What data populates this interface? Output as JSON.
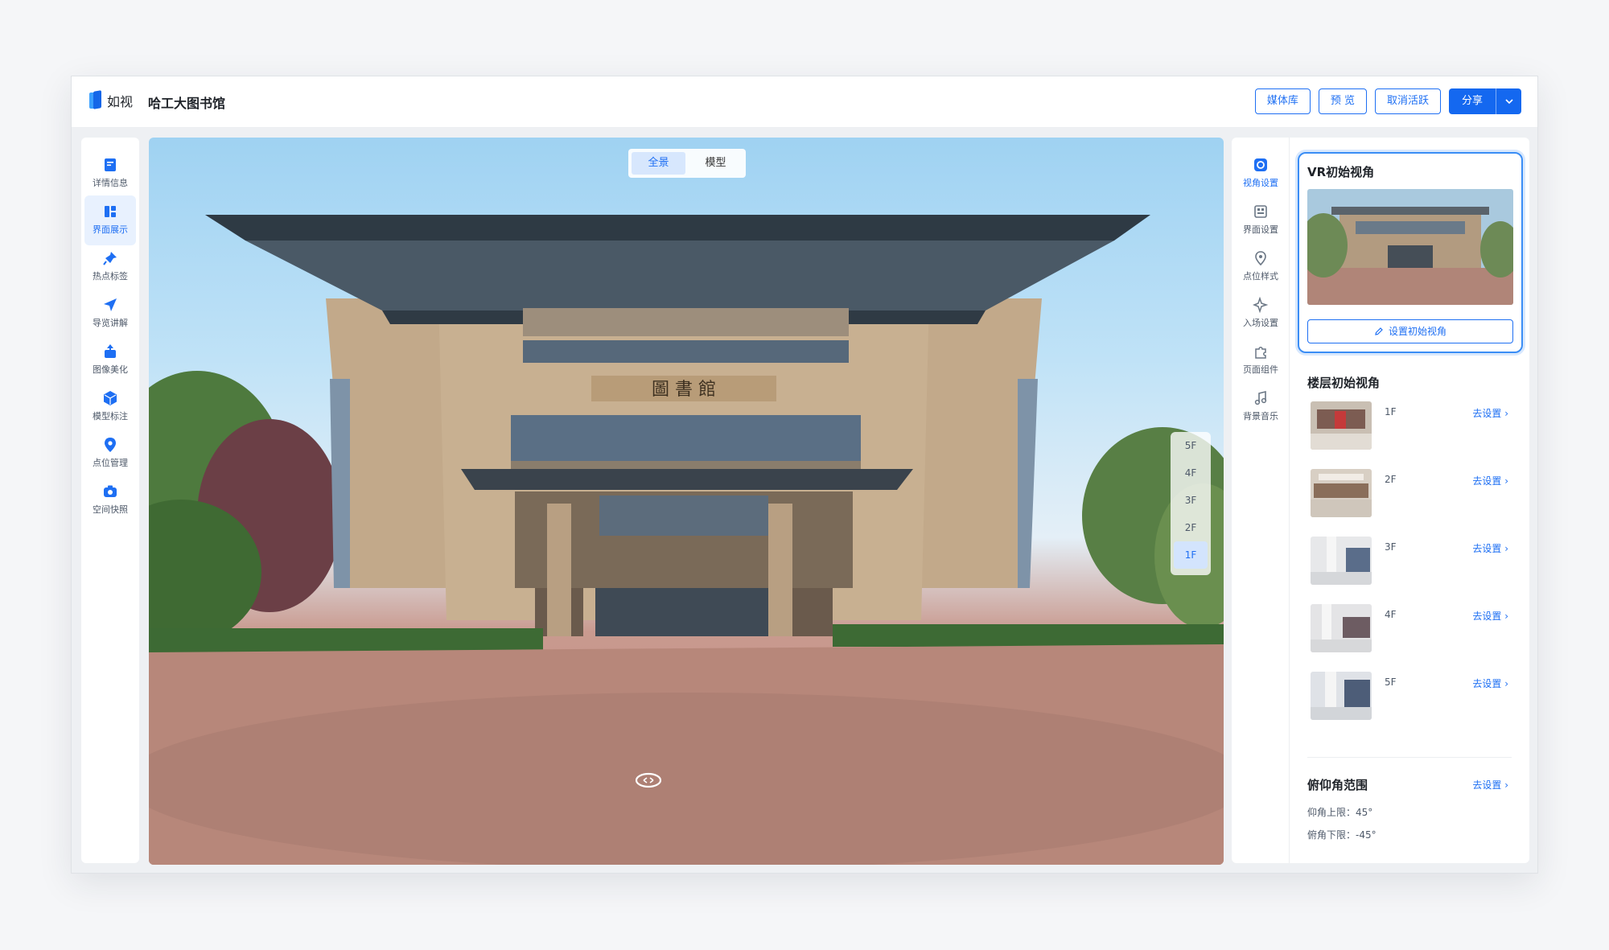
{
  "header": {
    "logo_text": "如视",
    "project_title": "哈工大图书馆",
    "buttons": {
      "media": "媒体库",
      "preview": "预 览",
      "deactivate": "取消活跃",
      "share": "分享"
    }
  },
  "left_nav": {
    "items": [
      {
        "label": "详情信息",
        "icon": "document-icon",
        "active": false
      },
      {
        "label": "界面展示",
        "icon": "layout-icon",
        "active": true
      },
      {
        "label": "热点标签",
        "icon": "pin-icon",
        "active": false
      },
      {
        "label": "导览讲解",
        "icon": "navigate-icon",
        "active": false
      },
      {
        "label": "图像美化",
        "icon": "image-enhance-icon",
        "active": false
      },
      {
        "label": "模型标注",
        "icon": "model-icon",
        "active": false
      },
      {
        "label": "点位管理",
        "icon": "location-icon",
        "active": false
      },
      {
        "label": "空间快照",
        "icon": "camera-icon",
        "active": false
      }
    ]
  },
  "viewer": {
    "mode_tabs": [
      "全景",
      "模型"
    ],
    "active_mode": "全景",
    "sign_text": "圖 書 館",
    "floors": [
      "5F",
      "4F",
      "3F",
      "2F",
      "1F"
    ],
    "active_floor": "1F"
  },
  "right_nav": {
    "items": [
      {
        "label": "视角设置",
        "icon": "view-angle-icon",
        "active": true
      },
      {
        "label": "界面设置",
        "icon": "ui-settings-icon",
        "active": false
      },
      {
        "label": "点位样式",
        "icon": "map-pin-icon",
        "active": false
      },
      {
        "label": "入场设置",
        "icon": "sparkle-icon",
        "active": false
      },
      {
        "label": "页面组件",
        "icon": "puzzle-icon",
        "active": false
      },
      {
        "label": "背景音乐",
        "icon": "music-icon",
        "active": false
      }
    ]
  },
  "panel": {
    "vr_title": "VR初始视角",
    "set_initial_view": "设置初始视角",
    "floor_section_title": "楼层初始视角",
    "floor_rows": [
      {
        "floor": "1F",
        "action": "去设置"
      },
      {
        "floor": "2F",
        "action": "去设置"
      },
      {
        "floor": "3F",
        "action": "去设置"
      },
      {
        "floor": "4F",
        "action": "去设置"
      },
      {
        "floor": "5F",
        "action": "去设置"
      }
    ],
    "pitch_title": "俯仰角范围",
    "pitch_action": "去设置",
    "pitch_upper": "仰角上限：45°",
    "pitch_lower": "俯角下限：-45°"
  },
  "colors": {
    "accent": "#1e6ff3",
    "accent_light": "#e8f1fe",
    "panel_bg": "#ffffff",
    "page_bg": "#f5f6f8"
  }
}
